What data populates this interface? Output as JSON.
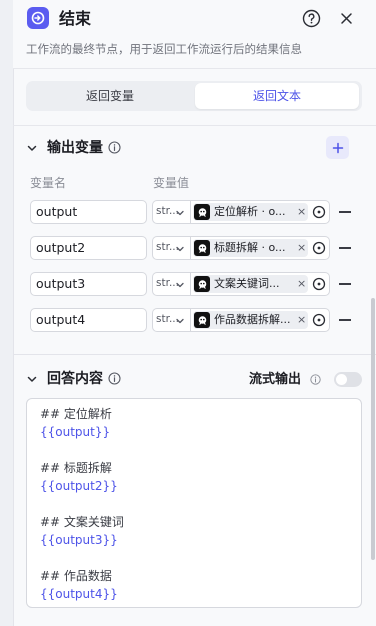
{
  "header": {
    "title": "结束",
    "subtitle": "工作流的最终节点，用于返回工作流运行后的结果信息"
  },
  "tabs": [
    {
      "label": "返回变量",
      "active": false
    },
    {
      "label": "返回文本",
      "active": true
    }
  ],
  "output_section": {
    "title": "输出变量",
    "col_name": "变量名",
    "col_value": "变量值",
    "rows": [
      {
        "name": "output",
        "type": "str...",
        "ref": "定位解析 · o..."
      },
      {
        "name": "output2",
        "type": "str...",
        "ref": "标题拆解 · o..."
      },
      {
        "name": "output3",
        "type": "str...",
        "ref": "文案关键词..."
      },
      {
        "name": "output4",
        "type": "str...",
        "ref": "作品数据拆解..."
      }
    ]
  },
  "answer_section": {
    "title": "回答内容",
    "stream_label": "流式输出",
    "stream_enabled": false,
    "lines": [
      {
        "text": "## 定位解析",
        "kind": "heading"
      },
      {
        "text": "{{output}}",
        "kind": "var"
      },
      {
        "text": "## 标题拆解",
        "kind": "heading"
      },
      {
        "text": "{{output2}}",
        "kind": "var"
      },
      {
        "text": "## 文案关键词",
        "kind": "heading"
      },
      {
        "text": "{{output3}}",
        "kind": "var"
      },
      {
        "text": "## 作品数据",
        "kind": "heading"
      },
      {
        "text": "{{output4}}",
        "kind": "var"
      }
    ]
  },
  "colors": {
    "accent": "#4d53e8",
    "node_icon": "#5b5cf0"
  }
}
